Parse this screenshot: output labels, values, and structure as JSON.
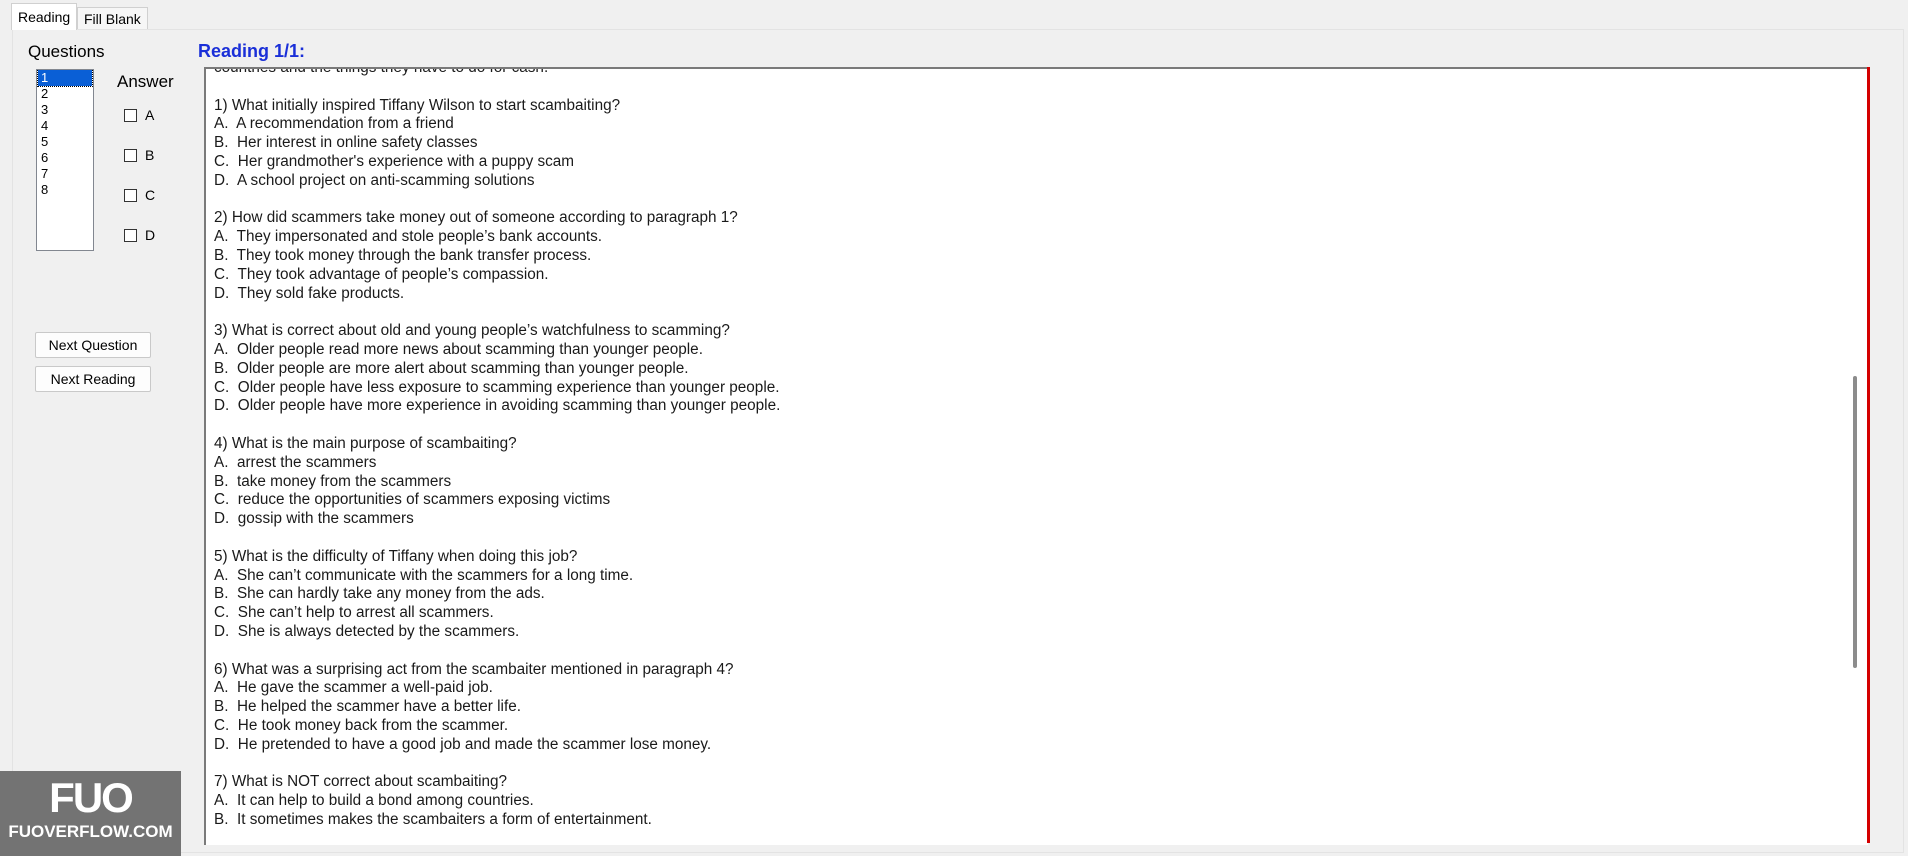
{
  "tabs": [
    {
      "label": "Reading",
      "active": true
    },
    {
      "label": "Fill Blank",
      "active": false
    }
  ],
  "questions_label": "Questions",
  "question_list": [
    "1",
    "2",
    "3",
    "4",
    "5",
    "6",
    "7",
    "8"
  ],
  "selected_question": "1",
  "answer_label": "Answer",
  "answer_options": [
    "A",
    "B",
    "C",
    "D"
  ],
  "buttons": {
    "next_question": "Next Question",
    "next_reading": "Next Reading"
  },
  "reading_title": "Reading 1/1:",
  "reading_lines": [
    "countries and the things they have to do for cash.",
    "",
    "1) What initially inspired Tiffany Wilson to start scambaiting?",
    "A.  A recommendation from a friend",
    "B.  Her interest in online safety classes",
    "C.  Her grandmother's experience with a puppy scam",
    "D.  A school project on anti-scamming solutions",
    "",
    "2) How did scammers take money out of someone according to paragraph 1?",
    "A.  They impersonated and stole people’s bank accounts.",
    "B.  They took money through the bank transfer process.",
    "C.  They took advantage of people’s compassion.",
    "D.  They sold fake products.",
    "",
    "3) What is correct about old and young people’s watchfulness to scamming?",
    "A.  Older people read more news about scamming than younger people.",
    "B.  Older people are more alert about scamming than younger people.",
    "C.  Older people have less exposure to scamming experience than younger people.",
    "D.  Older people have more experience in avoiding scamming than younger people.",
    "",
    "4) What is the main purpose of scambaiting?",
    "A.  arrest the scammers",
    "B.  take money from the scammers",
    "C.  reduce the opportunities of scammers exposing victims",
    "D.  gossip with the scammers",
    "",
    "5) What is the difficulty of Tiffany when doing this job?",
    "A.  She can’t communicate with the scammers for a long time.",
    "B.  She can hardly take any money from the ads.",
    "C.  She can’t help to arrest all scammers.",
    "D.  She is always detected by the scammers.",
    "",
    "6) What was a surprising act from the scambaiter mentioned in paragraph 4?",
    "A.  He gave the scammer a well-paid job.",
    "B.  He helped the scammer have a better life.",
    "C.  He took money back from the scammer.",
    "D.  He pretended to have a good job and made the scammer lose money.",
    "",
    "7) What is NOT correct about scambaiting?",
    "A.  It can help to build a bond among countries.",
    "B.  It sometimes makes the scambaiters a form of entertainment."
  ],
  "watermark": {
    "mark": "FUO",
    "text": "FUOVERFLOW.COM"
  },
  "colors": {
    "title_blue": "#1a2fd8",
    "selection_blue": "#0a5fd6",
    "red_border": "#d40000"
  }
}
